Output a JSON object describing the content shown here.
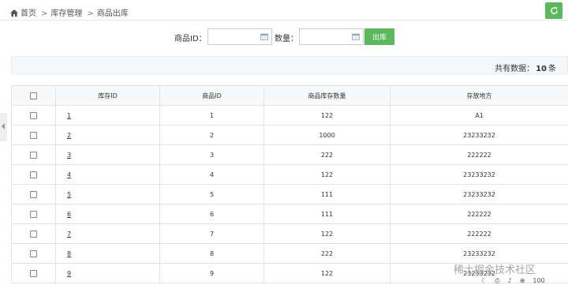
{
  "breadcrumb": {
    "items": [
      "首页",
      "库存管理",
      "商品出库"
    ],
    "separator": ">"
  },
  "form": {
    "product_id_label": "商品ID：",
    "product_id_value": "",
    "quantity_label": "数量：",
    "quantity_value": "",
    "submit_label": "出库"
  },
  "summary": {
    "prefix": "共有数据：",
    "count": "10",
    "suffix": "条"
  },
  "table": {
    "headers": [
      "库存ID",
      "商品ID",
      "商品库存数量",
      "存放地方"
    ],
    "rows": [
      {
        "stock_id": "1",
        "product_id": "1",
        "qty": "122",
        "location": "A1"
      },
      {
        "stock_id": "2",
        "product_id": "2",
        "qty": "1000",
        "location": "23233232"
      },
      {
        "stock_id": "3",
        "product_id": "3",
        "qty": "222",
        "location": "222222"
      },
      {
        "stock_id": "4",
        "product_id": "4",
        "qty": "122",
        "location": "23233232"
      },
      {
        "stock_id": "5",
        "product_id": "5",
        "qty": "111",
        "location": "23233232"
      },
      {
        "stock_id": "6",
        "product_id": "6",
        "qty": "111",
        "location": "222222"
      },
      {
        "stock_id": "7",
        "product_id": "7",
        "qty": "122",
        "location": "222222"
      },
      {
        "stock_id": "8",
        "product_id": "8",
        "qty": "222",
        "location": "23233232"
      },
      {
        "stock_id": "9",
        "product_id": "9",
        "qty": "122",
        "location": "23233232"
      }
    ]
  },
  "watermark": "稀土掘金技术社区",
  "status_strip": {
    "zoom": "100"
  },
  "colors": {
    "accent_green": "#5cb85c",
    "header_bg": "#f7f9fb",
    "summary_bg": "#f5f8fb"
  },
  "icons": {
    "home": "home-icon",
    "refresh": "refresh-icon",
    "calendar": "calendar-icon",
    "checkbox": "checkbox-icon"
  }
}
